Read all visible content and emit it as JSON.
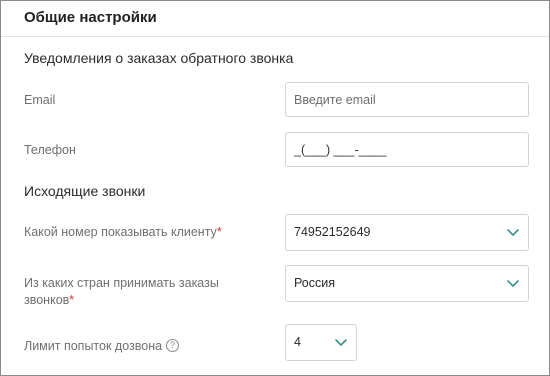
{
  "section": {
    "title": "Общие настройки"
  },
  "notifications": {
    "title": "Уведомления о заказах обратного звонка",
    "email_label": "Email",
    "email_placeholder": "Введите email",
    "email_value": "",
    "phone_label": "Телефон",
    "phone_value": "_(___) ___-____"
  },
  "outgoing": {
    "title": "Исходящие звонки",
    "number_label": "Какой номер показывать клиенту",
    "number_value": "74952152649",
    "countries_label_line1": "Из каких стран принимать заказы",
    "countries_label_line2": "звонков",
    "countries_value": "Россия",
    "attempts_label": "Лимит попыток дозвона",
    "attempts_help": "?",
    "attempts_value": "4",
    "required_mark": "*"
  },
  "icons": {
    "select_chevron": "chevron-down-icon",
    "help": "question-circle-icon"
  },
  "colors": {
    "required": "#d9342b",
    "border": "#d3d3d3",
    "label": "#6f6f6f",
    "chevron": "#3a8f8a"
  }
}
